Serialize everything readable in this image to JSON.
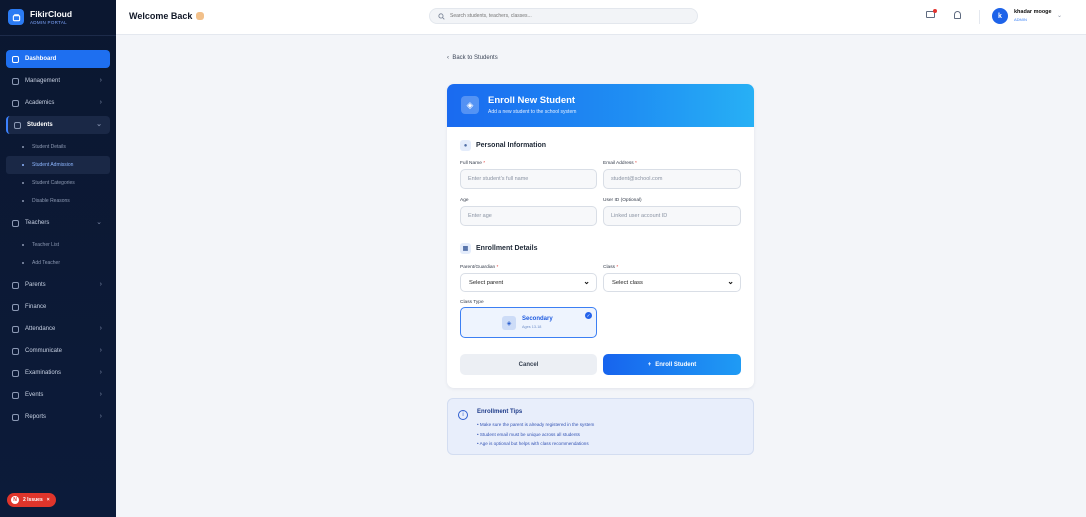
{
  "brand": {
    "title": "FikirCloud",
    "subtitle": "ADMIN PORTAL"
  },
  "sidebar": {
    "items": [
      {
        "label": "Dashboard"
      },
      {
        "label": "Management"
      },
      {
        "label": "Academics"
      },
      {
        "label": "Students"
      },
      {
        "label": "Teachers"
      },
      {
        "label": "Parents"
      },
      {
        "label": "Finance"
      },
      {
        "label": "Attendance"
      },
      {
        "label": "Communicate"
      },
      {
        "label": "Examinations"
      },
      {
        "label": "Events"
      },
      {
        "label": "Reports"
      }
    ],
    "students_sub": [
      "Student Details",
      "Student Admission",
      "Student Categories",
      "Disable Reasons"
    ],
    "teachers_sub": [
      "Teacher List",
      "Add Teacher"
    ],
    "issues": {
      "count": "N",
      "label": "2 Issues"
    }
  },
  "header": {
    "welcome": "Welcome Back",
    "search_placeholder": "Search students, teachers, classes...",
    "user": {
      "initial": "k",
      "name": "khadar mooge",
      "role": "ADMIN"
    }
  },
  "page": {
    "back": "Back to Students",
    "card_title": "Enroll New Student",
    "card_subtitle": "Add a new student to the school system",
    "personal": {
      "title": "Personal Information",
      "full_name_label": "Full Name",
      "full_name_placeholder": "Enter student's full name",
      "email_label": "Email Address",
      "email_placeholder": "student@school.com",
      "age_label": "Age",
      "age_placeholder": "Enter age",
      "userid_label": "User ID (Optional)",
      "userid_placeholder": "Linked user account ID"
    },
    "enrollment": {
      "title": "Enrollment Details",
      "parent_label": "Parent/Guardian",
      "parent_value": "Select parent",
      "class_label": "Class",
      "class_value": "Select class",
      "class_type_label": "Class Type",
      "class_type_name": "Secondary",
      "class_type_ages": "Ages 13-18"
    },
    "cancel": "Cancel",
    "enroll": "Enroll Student",
    "tips": {
      "title": "Enrollment Tips",
      "items": [
        "• Make sure the parent is already registered in the system",
        "• Student email must be unique across all students",
        "• Age is optional but helps with class recommendations"
      ]
    }
  },
  "colors": {
    "sidebar": "#0b1730",
    "accent": "#1e6ff0",
    "danger": "#e0352b"
  }
}
